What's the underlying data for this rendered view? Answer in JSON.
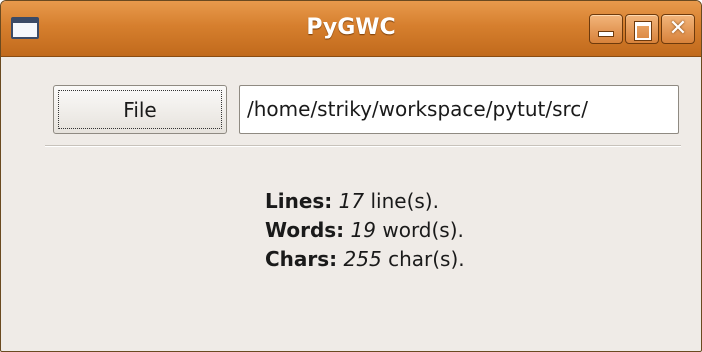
{
  "window": {
    "title": "PyGWC"
  },
  "toolbar": {
    "file_button_label": "File",
    "path_value": "/home/striky/workspace/pytut/src/"
  },
  "stats": {
    "lines": {
      "label": "Lines:",
      "value": "17",
      "unit": "line(s)."
    },
    "words": {
      "label": "Words:",
      "value": "19",
      "unit": "word(s)."
    },
    "chars": {
      "label": "Chars:",
      "value": "255",
      "unit": "char(s)."
    }
  },
  "colors": {
    "titlebar": "#d67f2e",
    "window_bg": "#efebe7"
  },
  "icons": {
    "app": "window-app-icon",
    "minimize": "minimize-icon",
    "maximize": "maximize-icon",
    "close": "close-icon"
  }
}
